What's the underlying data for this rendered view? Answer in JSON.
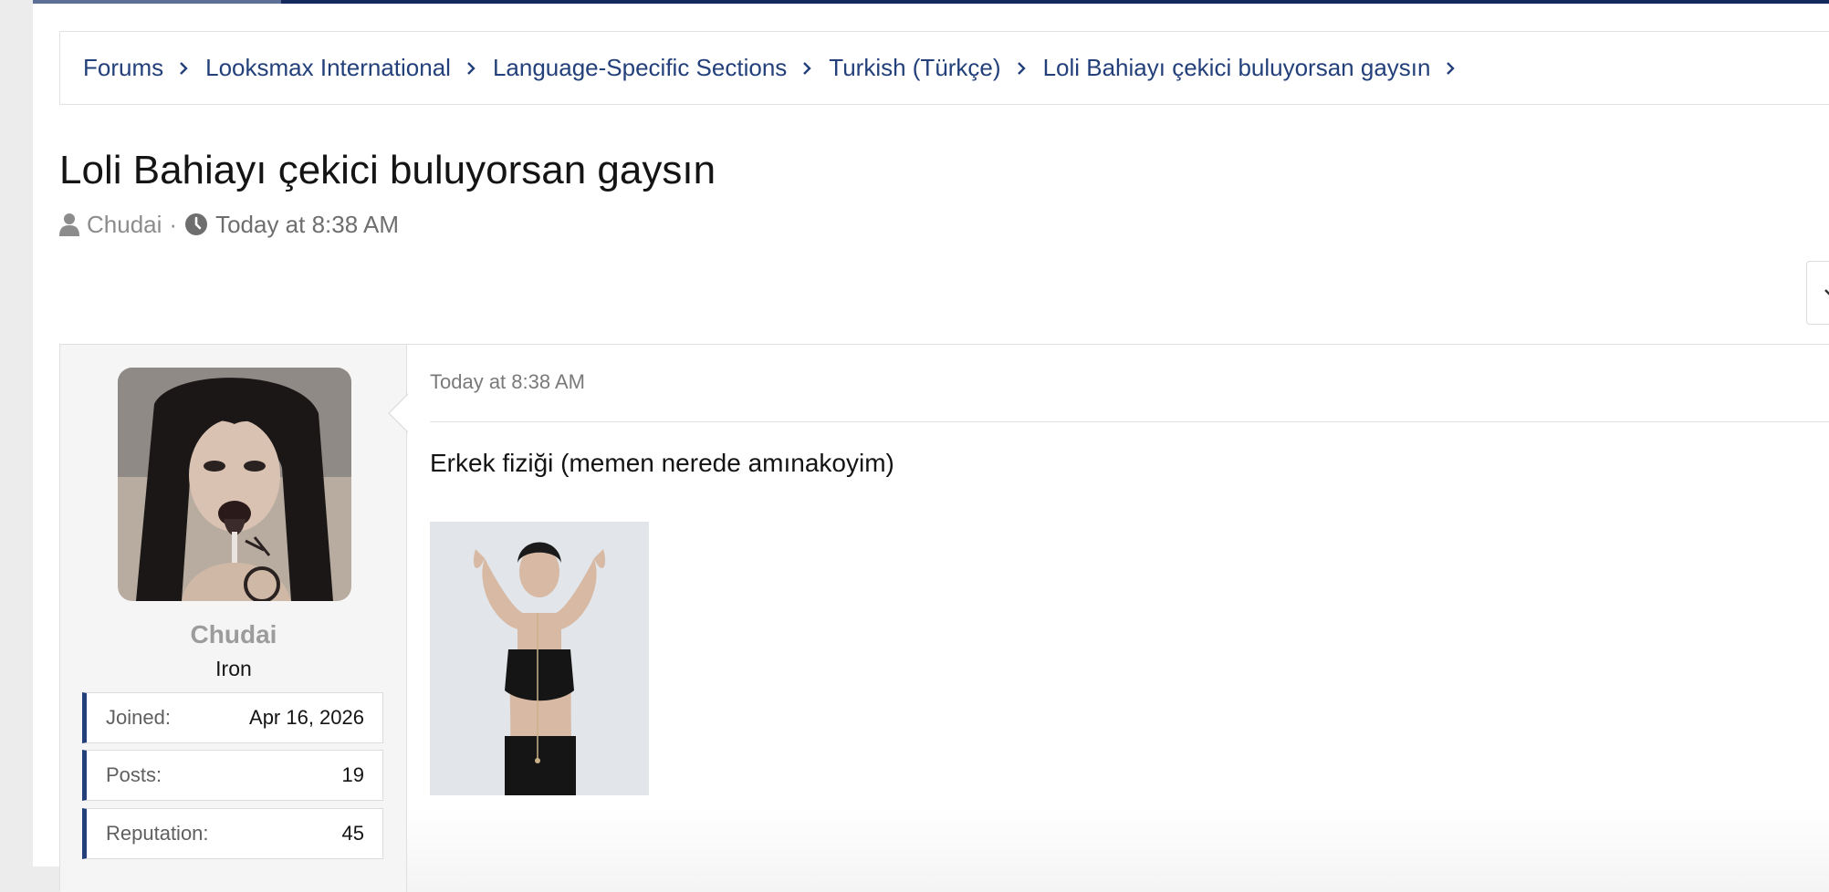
{
  "colors": {
    "accent": "#23407a",
    "top_bar": "#14295c",
    "username": "#9c9c9c"
  },
  "breadcrumbs": [
    {
      "label": "Forums"
    },
    {
      "label": "Looksmax International"
    },
    {
      "label": "Language-Specific Sections"
    },
    {
      "label": "Turkish (Türkçe)"
    },
    {
      "label": "Loli Bahiayı çekici buluyorsan gaysın"
    }
  ],
  "thread": {
    "title": "Loli Bahiayı çekici buluyorsan gaysın",
    "author": "Chudai",
    "separator": "·",
    "date": "Today at 8:38 AM",
    "author_icon": "user-icon",
    "time_icon": "clock-icon"
  },
  "post": {
    "user": {
      "name": "Chudai",
      "title": "Iron",
      "stats": [
        {
          "label": "Joined:",
          "value": "Apr 16, 2026"
        },
        {
          "label": "Posts:",
          "value": "19"
        },
        {
          "label": "Reputation:",
          "value": "45"
        }
      ]
    },
    "date": "Today at 8:38 AM",
    "text": "Erkek fiziği (memen nerede amınakoyim)"
  }
}
